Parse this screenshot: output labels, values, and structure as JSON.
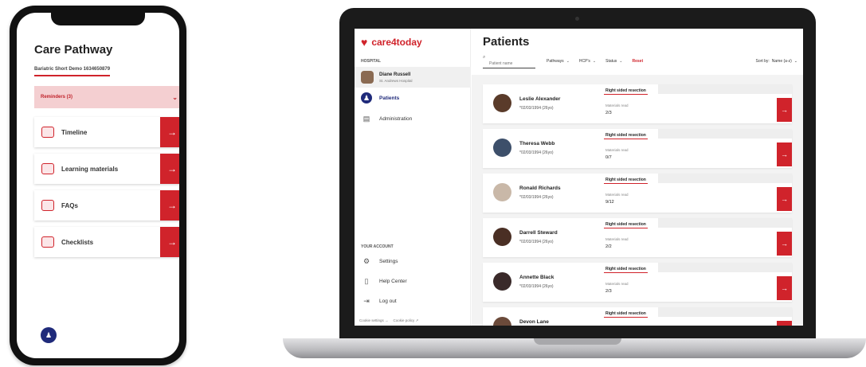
{
  "mobile": {
    "title": "Care Pathway",
    "subtitle": "Bariatric Short Demo 1634650879",
    "reminders_label": "Reminders (3)",
    "menu": [
      {
        "label": "Timeline",
        "icon": "timeline-icon"
      },
      {
        "label": "Learning materials",
        "icon": "learning-materials-icon"
      },
      {
        "label": "FAQs",
        "icon": "faq-icon"
      },
      {
        "label": "Checklists",
        "icon": "checklist-icon"
      }
    ]
  },
  "desktop": {
    "brand": "care4today",
    "hospital_label": "HOSPITAL",
    "user": {
      "name": "Diane Russell",
      "hospital": "St. Andrews Hospital"
    },
    "nav": [
      {
        "label": "Patients",
        "icon": "patients-icon",
        "active": true
      },
      {
        "label": "Administration",
        "icon": "administration-icon",
        "active": false
      }
    ],
    "account_label": "YOUR ACCOUNT",
    "account_nav": [
      {
        "label": "Settings",
        "icon": "gear-icon"
      },
      {
        "label": "Help Center",
        "icon": "help-icon"
      },
      {
        "label": "Log out",
        "icon": "logout-icon"
      }
    ],
    "footer": {
      "cookie_settings": "Cookie settings →",
      "cookie_policy": "Cookie policy ↗"
    },
    "page_title": "Patients",
    "filters": {
      "search_placeholder": "Patient name",
      "pathways": "Pathways",
      "hcps": "HCP's",
      "status": "Status",
      "reset": "Reset",
      "sort_by": "Sort by:",
      "sort_value": "Name (a-z)"
    },
    "patients": [
      {
        "name": "Leslie Alexander",
        "dob": "*02/03/1994 (26yo)",
        "pathway": "Right sided resection",
        "materials_label": "Materials read",
        "materials": "2/3",
        "avatar_color": "#5a3b2a"
      },
      {
        "name": "Theresa Webb",
        "dob": "*02/03/1994 (26yo)",
        "pathway": "Right sided resection",
        "materials_label": "Materials read",
        "materials": "0/7",
        "avatar_color": "#3d4f6a"
      },
      {
        "name": "Ronald Richards",
        "dob": "*02/03/1994 (26yo)",
        "pathway": "Right sided resection",
        "materials_label": "Materials read",
        "materials": "9/12",
        "avatar_color": "#c9b8a8"
      },
      {
        "name": "Darrell Steward",
        "dob": "*02/03/1994 (26yo)",
        "pathway": "Right sided resection",
        "materials_label": "Materials read",
        "materials": "2/2",
        "avatar_color": "#4a2f24"
      },
      {
        "name": "Annette Black",
        "dob": "*02/03/1994 (26yo)",
        "pathway": "Right sided resection",
        "materials_label": "Materials read",
        "materials": "2/3",
        "avatar_color": "#3a2a2a"
      },
      {
        "name": "Devon Lane",
        "dob": "",
        "pathway": "Right sided resection",
        "materials_label": "",
        "materials": "",
        "avatar_color": "#6b4a3a"
      }
    ]
  },
  "colors": {
    "accent": "#d0232b",
    "navy": "#1f2a7a"
  }
}
